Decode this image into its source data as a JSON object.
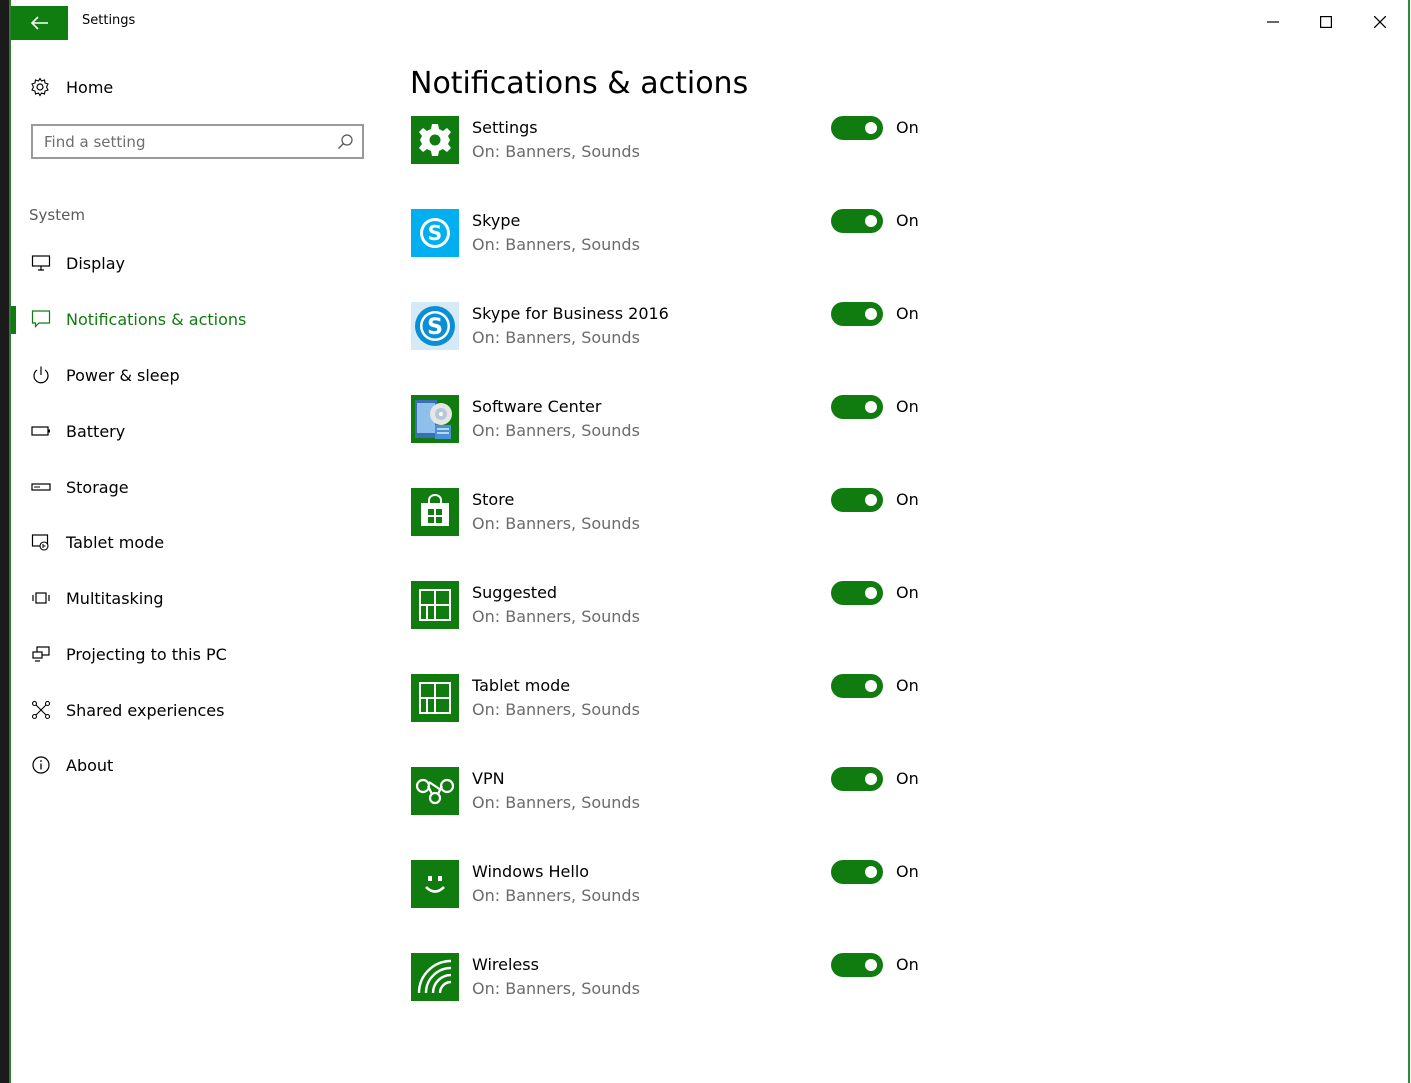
{
  "window": {
    "title": "Settings",
    "accent": "#107c10"
  },
  "sidebar": {
    "home_label": "Home",
    "search_placeholder": "Find a setting",
    "section": "System",
    "items": [
      {
        "label": "Display",
        "icon": "display-icon"
      },
      {
        "label": "Notifications & actions",
        "icon": "notification-icon",
        "active": true
      },
      {
        "label": "Power & sleep",
        "icon": "power-icon"
      },
      {
        "label": "Battery",
        "icon": "battery-icon"
      },
      {
        "label": "Storage",
        "icon": "storage-icon"
      },
      {
        "label": "Tablet mode",
        "icon": "tablet-mode-icon"
      },
      {
        "label": "Multitasking",
        "icon": "multitasking-icon"
      },
      {
        "label": "Projecting to this PC",
        "icon": "projecting-icon"
      },
      {
        "label": "Shared experiences",
        "icon": "shared-experiences-icon"
      },
      {
        "label": "About",
        "icon": "info-icon"
      }
    ]
  },
  "main": {
    "title": "Notifications & actions",
    "apps": [
      {
        "name": "Settings",
        "status": "On: Banners, Sounds",
        "toggle": "On",
        "icon": "settings-gear-icon"
      },
      {
        "name": "Skype",
        "status": "On: Banners, Sounds",
        "toggle": "On",
        "icon": "skype-icon"
      },
      {
        "name": "Skype for Business 2016",
        "status": "On: Banners, Sounds",
        "toggle": "On",
        "icon": "skype-business-icon"
      },
      {
        "name": "Software Center",
        "status": "On: Banners, Sounds",
        "toggle": "On",
        "icon": "software-center-icon"
      },
      {
        "name": "Store",
        "status": "On: Banners, Sounds",
        "toggle": "On",
        "icon": "store-icon"
      },
      {
        "name": "Suggested",
        "status": "On: Banners, Sounds",
        "toggle": "On",
        "icon": "suggested-icon"
      },
      {
        "name": "Tablet mode",
        "status": "On: Banners, Sounds",
        "toggle": "On",
        "icon": "tablet-mode-app-icon"
      },
      {
        "name": "VPN",
        "status": "On: Banners, Sounds",
        "toggle": "On",
        "icon": "vpn-icon"
      },
      {
        "name": "Windows Hello",
        "status": "On: Banners, Sounds",
        "toggle": "On",
        "icon": "windows-hello-icon"
      },
      {
        "name": "Wireless",
        "status": "On: Banners, Sounds",
        "toggle": "On",
        "icon": "wireless-icon"
      }
    ]
  }
}
